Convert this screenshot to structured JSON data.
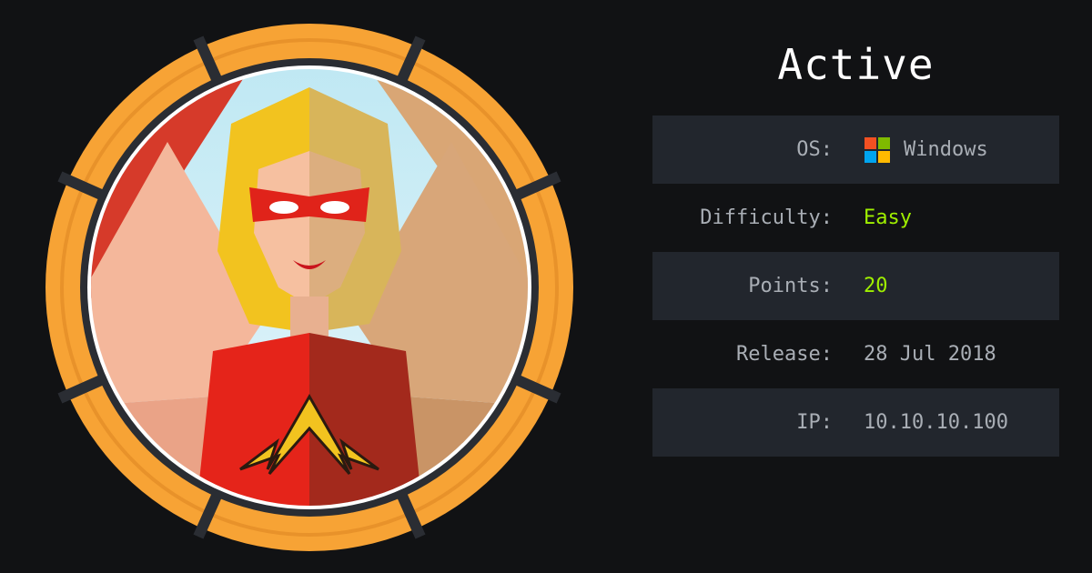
{
  "machine": {
    "name": "Active",
    "info": [
      {
        "label": "OS:",
        "value": "Windows",
        "icon": "windows-logo-icon"
      },
      {
        "label": "Difficulty:",
        "value": "Easy",
        "accent": true
      },
      {
        "label": "Points:",
        "value": "20",
        "accent": true
      },
      {
        "label": "Release:",
        "value": "28 Jul 2018"
      },
      {
        "label": "IP:",
        "value": "10.10.10.100"
      }
    ]
  },
  "colors": {
    "background": "#111214",
    "ring": "#f7a335",
    "accent": "#9fef00",
    "muted_text": "#a9aeb5",
    "row_shade": "#22262d"
  }
}
